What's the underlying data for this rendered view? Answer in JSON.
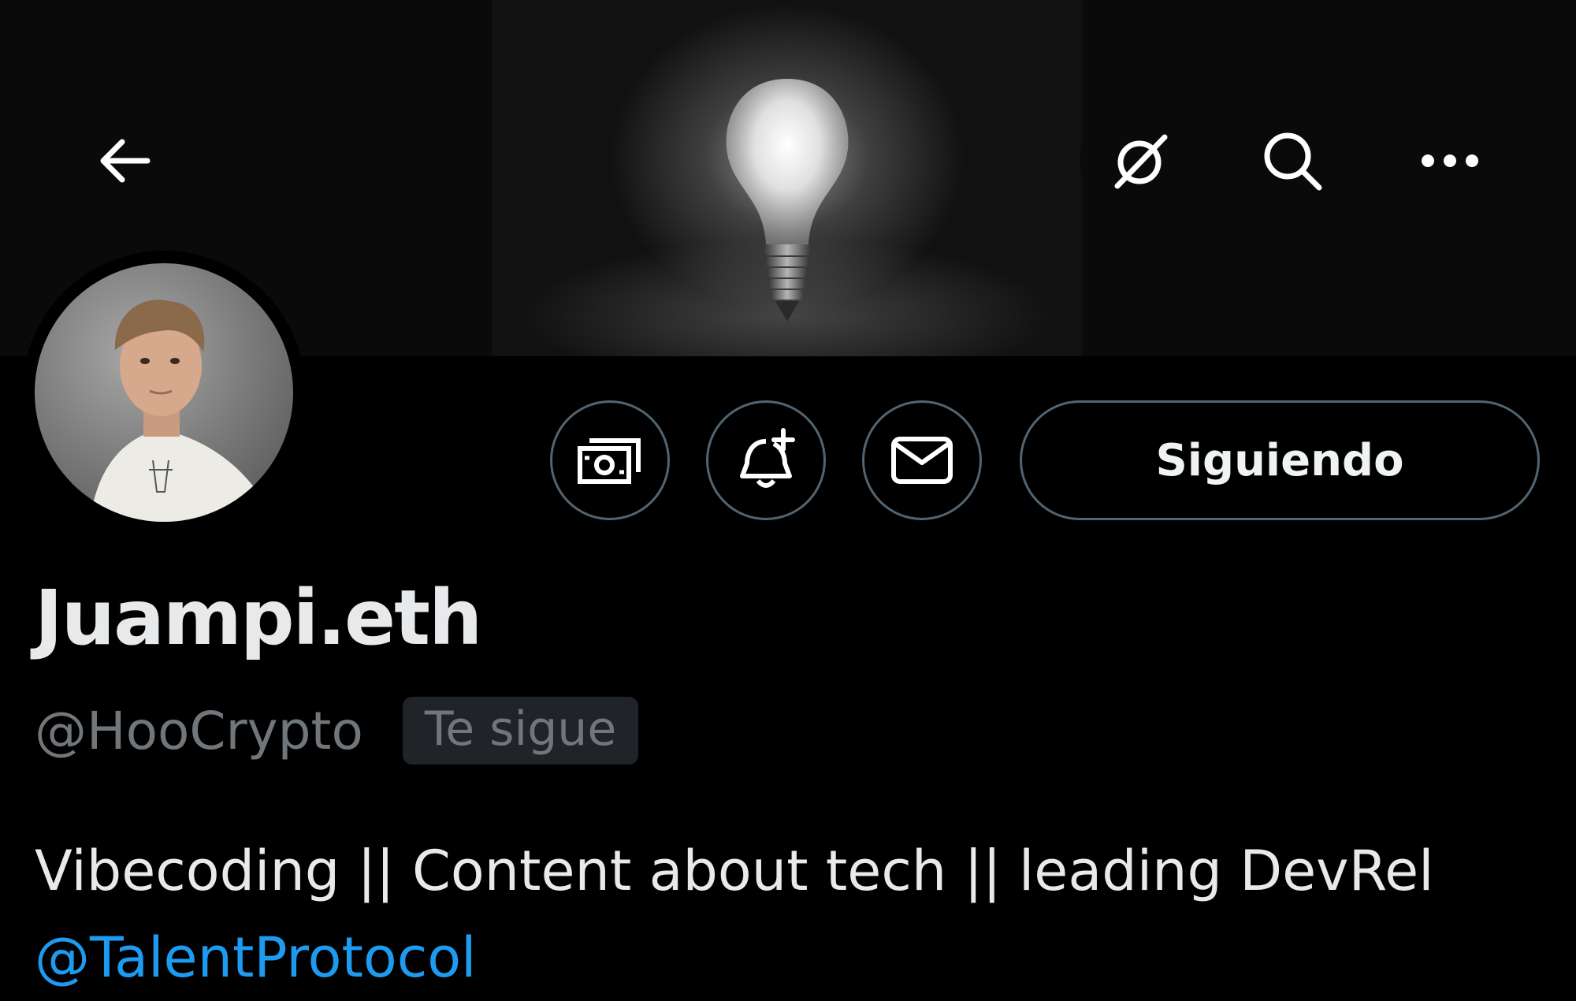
{
  "profile": {
    "display_name": "Juampi.eth",
    "handle": "@HooCrypto",
    "follows_you_badge": "Te sigue",
    "bio_text": "Vibecoding || Content about tech || leading DevRel",
    "bio_mention": "@TalentProtocol"
  },
  "actions": {
    "follow_label": "Siguiendo"
  },
  "icons": {
    "back": "arrow-left-icon",
    "grok": "grok-icon",
    "search": "search-icon",
    "more": "more-horizontal-icon",
    "tip": "money-icon",
    "notify": "bell-plus-icon",
    "message": "envelope-icon"
  },
  "colors": {
    "background": "#000000",
    "text_primary": "#e7e9ea",
    "text_secondary": "#71767b",
    "accent_link": "#1d9bf0",
    "button_border": "#536471",
    "badge_background": "#202327"
  }
}
